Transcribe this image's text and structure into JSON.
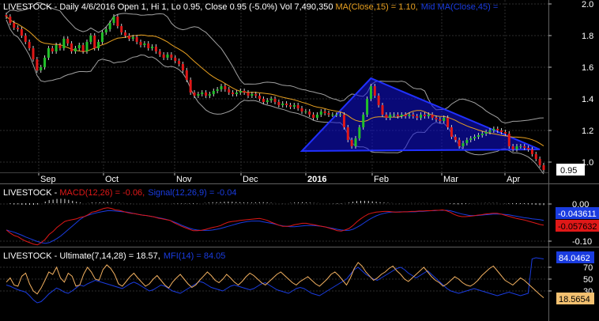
{
  "main_header": {
    "symbol": "LIVESTOCK",
    "info": " - Daily 4/6/2016 Open 1, Hi 1, Lo 0.95, Close 0.95 (-5.0%) Vol 7,490,350 ",
    "ma_label": "MA(Close,15) = 1.10,",
    "mid_ma_label": "Mid MA(Close,45) ="
  },
  "macd_header": {
    "symbol": "LIVESTOCK",
    "macd_label": "MACD(12,26) = -0.06,",
    "signal_label": "Signal(12,26,9) = -0.04"
  },
  "ult_header": {
    "symbol": "LIVESTOCK",
    "ult_label": "Ultimate(7,14,28) = 18.57,",
    "mfi_label": "MFI(14) = 84.05"
  },
  "colors": {
    "bg": "#000000",
    "grid": "#2e2e2e",
    "up": "#22c02a",
    "down": "#e01818",
    "ma": "#e8a020",
    "bands": "#a0a0a0",
    "triangle": "#1010d8",
    "macd": "#e01818",
    "signal": "#1a3ce0",
    "ultimate": "#f2b060",
    "mfi": "#1a3ce0",
    "axis_text": "#ffffff",
    "tag_bg": "#ffffff",
    "tag_text": "#000000"
  },
  "chart_data": [
    {
      "type": "candlestick",
      "title": "LIVESTOCK - Daily",
      "y_ticks": [
        "2.0",
        "1.8",
        "1.6",
        "1.4",
        "1.2",
        "1.0"
      ],
      "ylim": [
        0.92,
        2.02
      ],
      "x_labels": [
        "Sep",
        "Oct",
        "Nov",
        "Dec",
        "2016",
        "Feb",
        "Mar",
        "Apr"
      ],
      "last_close_tag": "0.95",
      "closes": [
        1.92,
        1.88,
        1.85,
        1.84,
        1.8,
        1.76,
        1.72,
        1.65,
        1.58,
        1.6,
        1.66,
        1.72,
        1.7,
        1.74,
        1.72,
        1.78,
        1.75,
        1.7,
        1.72,
        1.74,
        1.7,
        1.76,
        1.8,
        1.72,
        1.76,
        1.82,
        1.84,
        1.88,
        1.92,
        1.86,
        1.82,
        1.8,
        1.78,
        1.79,
        1.76,
        1.74,
        1.75,
        1.72,
        1.73,
        1.7,
        1.68,
        1.66,
        1.68,
        1.66,
        1.64,
        1.62,
        1.58,
        1.52,
        1.44,
        1.42,
        1.43,
        1.44,
        1.42,
        1.43,
        1.45,
        1.46,
        1.48,
        1.46,
        1.44,
        1.43,
        1.44,
        1.45,
        1.44,
        1.42,
        1.43,
        1.42,
        1.4,
        1.38,
        1.39,
        1.4,
        1.38,
        1.36,
        1.37,
        1.36,
        1.35,
        1.36,
        1.34,
        1.32,
        1.32,
        1.3,
        1.28,
        1.3,
        1.32,
        1.31,
        1.3,
        1.3,
        1.3,
        1.3,
        1.22,
        1.14,
        1.1,
        1.15,
        1.22,
        1.3,
        1.4,
        1.48,
        1.42,
        1.36,
        1.3,
        1.28,
        1.3,
        1.3,
        1.29,
        1.3,
        1.29,
        1.3,
        1.29,
        1.28,
        1.3,
        1.29,
        1.3,
        1.28,
        1.27,
        1.26,
        1.28,
        1.22,
        1.16,
        1.14,
        1.1,
        1.12,
        1.14,
        1.15,
        1.16,
        1.17,
        1.18,
        1.19,
        1.2,
        1.21,
        1.2,
        1.19,
        1.18,
        1.1,
        1.08,
        1.1,
        1.1,
        1.09,
        1.08,
        1.05,
        1.02,
        0.98,
        0.95
      ],
      "ma_label": "MA(Close,15)",
      "ma_value": "1.10",
      "mid_ma_label": "Mid MA(Close,45)",
      "triangle": [
        [
          95,
          1.53
        ],
        [
          77,
          1.07
        ],
        [
          139,
          1.08
        ]
      ]
    },
    {
      "type": "line",
      "title": "MACD(12,26)",
      "y_ticks": [
        "0.00",
        "-0.10"
      ],
      "ylim": [
        -0.125,
        0.015
      ],
      "last_values": [
        "-0.043611",
        "-0.057632"
      ],
      "series": [
        {
          "name": "MACD(12,26)",
          "values": [
            -0.07,
            -0.078,
            -0.085,
            -0.088,
            -0.095,
            -0.1,
            -0.104,
            -0.108,
            -0.11,
            -0.104,
            -0.095,
            -0.082,
            -0.074,
            -0.063,
            -0.055,
            -0.047,
            -0.044,
            -0.042,
            -0.04,
            -0.036,
            -0.034,
            -0.029,
            -0.022,
            -0.02,
            -0.016,
            -0.012,
            -0.01,
            -0.012,
            -0.016,
            -0.017,
            -0.02,
            -0.023,
            -0.025,
            -0.026,
            -0.028,
            -0.03,
            -0.031,
            -0.033,
            -0.035,
            -0.038,
            -0.04,
            -0.042,
            -0.044,
            -0.05,
            -0.055,
            -0.06,
            -0.064,
            -0.068,
            -0.072,
            -0.072,
            -0.071,
            -0.069,
            -0.066,
            -0.063,
            -0.061,
            -0.058,
            -0.053,
            -0.049,
            -0.047,
            -0.046,
            -0.044,
            -0.043,
            -0.042,
            -0.041,
            -0.04,
            -0.039,
            -0.041,
            -0.044,
            -0.049,
            -0.053,
            -0.057,
            -0.06,
            -0.06,
            -0.059,
            -0.056,
            -0.054,
            -0.052,
            -0.052,
            -0.054,
            -0.056,
            -0.058,
            -0.06,
            -0.062,
            -0.065,
            -0.068,
            -0.072,
            -0.073,
            -0.07,
            -0.066,
            -0.058,
            -0.048,
            -0.04,
            -0.033,
            -0.027,
            -0.024,
            -0.022,
            -0.021,
            -0.02,
            -0.02,
            -0.021,
            -0.022,
            -0.022,
            -0.021,
            -0.021,
            -0.02,
            -0.02,
            -0.019,
            -0.019,
            -0.018,
            -0.018,
            -0.017,
            -0.017,
            -0.016,
            -0.018,
            -0.022,
            -0.028,
            -0.032,
            -0.034,
            -0.034,
            -0.033,
            -0.032,
            -0.03,
            -0.029,
            -0.027,
            -0.026,
            -0.025,
            -0.025,
            -0.027,
            -0.03,
            -0.033,
            -0.036,
            -0.039,
            -0.041,
            -0.043,
            -0.046,
            -0.049,
            -0.052,
            -0.055,
            -0.057
          ]
        },
        {
          "name": "Signal(12,26,9)",
          "values": [
            -0.07,
            -0.073,
            -0.076,
            -0.08,
            -0.084,
            -0.089,
            -0.093,
            -0.097,
            -0.101,
            -0.104,
            -0.106,
            -0.104,
            -0.099,
            -0.093,
            -0.086,
            -0.077,
            -0.068,
            -0.059,
            -0.05,
            -0.041,
            -0.034,
            -0.03,
            -0.027,
            -0.024,
            -0.022,
            -0.02,
            -0.018,
            -0.018,
            -0.019,
            -0.02,
            -0.021,
            -0.022,
            -0.024,
            -0.026,
            -0.028,
            -0.03,
            -0.031,
            -0.033,
            -0.035,
            -0.037,
            -0.039,
            -0.041,
            -0.044,
            -0.048,
            -0.052,
            -0.057,
            -0.061,
            -0.065,
            -0.068,
            -0.07,
            -0.071,
            -0.071,
            -0.071,
            -0.07,
            -0.068,
            -0.066,
            -0.063,
            -0.06,
            -0.057,
            -0.054,
            -0.051,
            -0.049,
            -0.047,
            -0.046,
            -0.046,
            -0.046,
            -0.048,
            -0.05,
            -0.052,
            -0.054,
            -0.057,
            -0.059,
            -0.06,
            -0.061,
            -0.061,
            -0.06,
            -0.059,
            -0.058,
            -0.058,
            -0.058,
            -0.059,
            -0.06,
            -0.062,
            -0.064,
            -0.066,
            -0.068,
            -0.07,
            -0.071,
            -0.071,
            -0.068,
            -0.063,
            -0.057,
            -0.05,
            -0.043,
            -0.037,
            -0.032,
            -0.028,
            -0.025,
            -0.023,
            -0.022,
            -0.022,
            -0.021,
            -0.021,
            -0.021,
            -0.021,
            -0.021,
            -0.02,
            -0.02,
            -0.019,
            -0.018,
            -0.018,
            -0.017,
            -0.017,
            -0.017,
            -0.018,
            -0.021,
            -0.024,
            -0.027,
            -0.029,
            -0.031,
            -0.031,
            -0.031,
            -0.03,
            -0.029,
            -0.028,
            -0.027,
            -0.027,
            -0.027,
            -0.028,
            -0.029,
            -0.031,
            -0.033,
            -0.035,
            -0.037,
            -0.038,
            -0.04,
            -0.041,
            -0.042,
            -0.044
          ]
        }
      ]
    },
    {
      "type": "line",
      "title": "Ultimate(7,14,28)",
      "y_ticks": [
        "70",
        "50",
        "30"
      ],
      "ylim": [
        5,
        95
      ],
      "last_values": [
        "84.0462",
        "18.5654"
      ],
      "series": [
        {
          "name": "Ultimate(7,14,28)",
          "values": [
            45,
            52,
            40,
            38,
            55,
            60,
            42,
            30,
            25,
            35,
            48,
            62,
            58,
            70,
            52,
            45,
            60,
            55,
            38,
            40,
            58,
            70,
            62,
            50,
            48,
            66,
            74,
            68,
            58,
            42,
            38,
            46,
            54,
            60,
            52,
            45,
            38,
            42,
            50,
            56,
            48,
            40,
            35,
            45,
            52,
            58,
            50,
            42,
            36,
            40,
            48,
            55,
            62,
            56,
            48,
            44,
            50,
            58,
            52,
            45,
            40,
            46,
            54,
            60,
            56,
            50,
            44,
            40,
            46,
            52,
            58,
            62,
            56,
            50,
            44,
            40,
            46,
            50,
            54,
            48,
            42,
            38,
            44,
            50,
            58,
            62,
            56,
            48,
            40,
            52,
            68,
            78,
            72,
            62,
            55,
            48,
            52,
            58,
            62,
            68,
            72,
            64,
            58,
            50,
            46,
            52,
            58,
            64,
            70,
            62,
            54,
            48,
            44,
            38,
            42,
            48,
            54,
            50,
            44,
            40,
            38,
            42,
            48,
            56,
            62,
            68,
            72,
            64,
            56,
            48,
            44,
            40,
            46,
            52,
            48,
            42,
            36,
            30,
            24,
            18.57
          ]
        },
        {
          "name": "MFI(14)",
          "values": [
            40,
            38,
            35,
            32,
            30,
            28,
            22,
            15,
            10,
            12,
            18,
            25,
            30,
            35,
            32,
            28,
            26,
            30,
            35,
            40,
            38,
            42,
            45,
            48,
            46,
            44,
            42,
            40,
            38,
            36,
            34,
            38,
            42,
            45,
            42,
            38,
            34,
            30,
            32,
            36,
            40,
            38,
            34,
            30,
            28,
            26,
            30,
            34,
            38,
            42,
            46,
            44,
            40,
            36,
            34,
            32,
            30,
            34,
            38,
            40,
            38,
            36,
            34,
            32,
            34,
            38,
            42,
            44,
            40,
            36,
            32,
            30,
            28,
            26,
            30,
            34,
            36,
            34,
            30,
            26,
            24,
            22,
            26,
            30,
            34,
            38,
            42,
            46,
            50,
            58,
            66,
            70,
            64,
            58,
            54,
            50,
            48,
            52,
            56,
            60,
            64,
            68,
            70,
            66,
            60,
            56,
            52,
            56,
            60,
            64,
            58,
            52,
            46,
            40,
            34,
            30,
            28,
            26,
            28,
            30,
            32,
            34,
            32,
            30,
            28,
            26,
            24,
            22,
            24,
            26,
            28,
            26,
            24,
            22,
            24,
            26,
            84.05,
            86,
            85,
            84.05
          ]
        }
      ]
    }
  ]
}
